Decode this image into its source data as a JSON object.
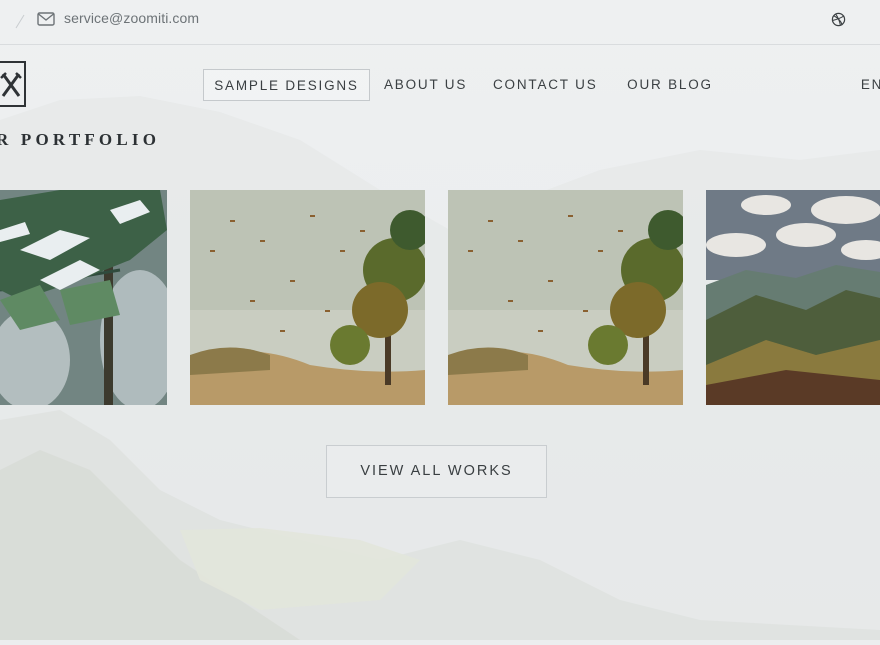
{
  "topbar": {
    "email": "service@zoomiti.com",
    "email_icon": "mail-icon",
    "social_icon": "dribbble-icon"
  },
  "logo": {
    "name": "logo-icon"
  },
  "nav": {
    "items": [
      {
        "label": "SAMPLE DESIGNS",
        "active": true
      },
      {
        "label": "ABOUT US",
        "active": false
      },
      {
        "label": "CONTACT US",
        "active": false
      },
      {
        "label": "OUR BLOG",
        "active": false
      },
      {
        "label": "EN",
        "active": false
      }
    ]
  },
  "portfolio": {
    "title": "R PORTFOLIO",
    "tiles": [
      {
        "subject": "snowy pine branch"
      },
      {
        "subject": "autumn leaves over tree hill"
      },
      {
        "subject": "autumn leaves over tree hill"
      },
      {
        "subject": "mountain valley with clouds"
      }
    ]
  },
  "cta": {
    "label": "VIEW ALL WORKS"
  },
  "colors": {
    "background": "#eceeef",
    "text": "#3b4043",
    "border": "#c5c9cc"
  }
}
